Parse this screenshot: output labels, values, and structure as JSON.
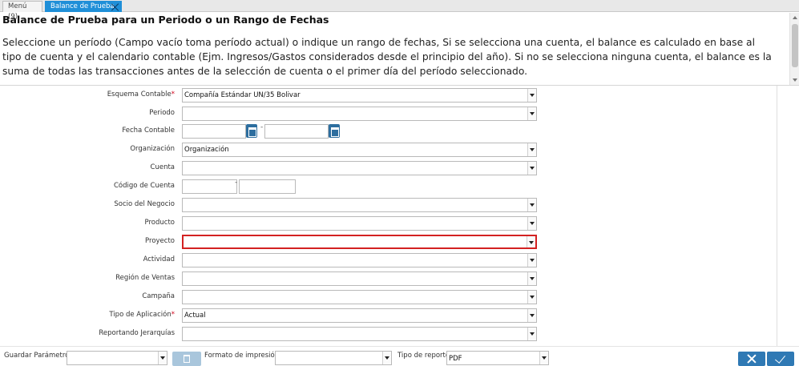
{
  "tabs": [
    {
      "label": "Menú (9)"
    },
    {
      "label": "Balance de Prueba"
    }
  ],
  "header": {
    "title": "Balance de Prueba para un Periodo o un Rango de Fechas",
    "description": "Seleccione un período (Campo vacío toma período actual) o indique un rango de fechas, Si se selecciona una cuenta, el balance es calculado en base al tipo de cuenta y el calendario contable (Ejm. Ingresos/Gastos considerados desde el principio del año). Si no se selecciona ninguna cuenta, el balance es la suma de todas las transacciones antes de la selección de cuenta o el primer día del período seleccionado."
  },
  "form": {
    "esquema_contable": {
      "label": "Esquema Contable",
      "required_mark": "*",
      "value": "Compañía Estándar UN/35 Bolivar"
    },
    "periodo": {
      "label": "Periodo",
      "value": ""
    },
    "fecha_contable": {
      "label": "Fecha Contable",
      "separator": "-",
      "from": "",
      "to": ""
    },
    "organizacion": {
      "label": "Organización",
      "value": "Organización"
    },
    "cuenta": {
      "label": "Cuenta",
      "value": ""
    },
    "codigo_cuenta": {
      "label": "Código de Cuenta",
      "separator": "-",
      "from": "",
      "to": ""
    },
    "socio_negocio": {
      "label": "Socio del Negocio",
      "value": ""
    },
    "producto": {
      "label": "Producto",
      "value": ""
    },
    "proyecto": {
      "label": "Proyecto",
      "value": ""
    },
    "actividad": {
      "label": "Actividad",
      "value": ""
    },
    "region_ventas": {
      "label": "Región de Ventas",
      "value": ""
    },
    "campana": {
      "label": "Campaña",
      "value": ""
    },
    "tipo_aplicacion": {
      "label": "Tipo de Aplicación",
      "required_mark": "*",
      "value": "Actual"
    },
    "reportando_jerarquias": {
      "label": "Reportando Jerarquías",
      "value": ""
    }
  },
  "footer": {
    "guardar_parametro": {
      "label": "Guardar Parámetro",
      "value": ""
    },
    "formato_impresion": {
      "label": "Formato de impresión",
      "value": ""
    },
    "tipo_reporte": {
      "label": "Tipo de reporte",
      "value": "PDF"
    }
  },
  "colors": {
    "accent": "#1f8fd8",
    "action_button": "#2f79b4",
    "error_border": "#d32121",
    "required": "#d0021b"
  },
  "icons": {
    "close_tab": "close-icon",
    "calendar": "calendar-icon",
    "dropdown": "chevron-down-icon",
    "delete": "trash-icon",
    "cancel": "x-icon",
    "ok": "check-icon"
  }
}
